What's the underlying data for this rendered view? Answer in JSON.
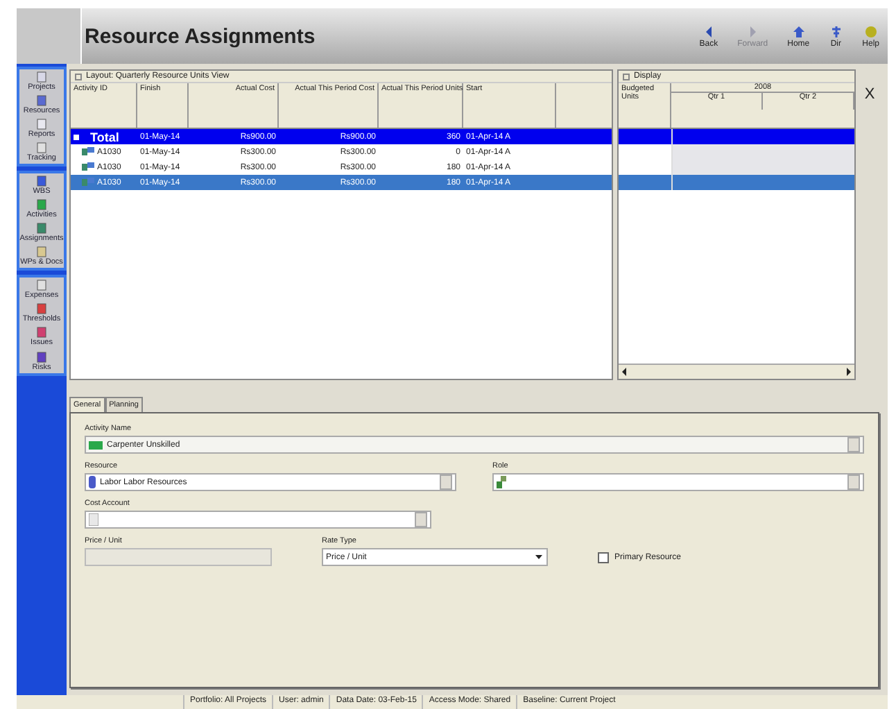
{
  "header": {
    "title": "Resource Assignments",
    "buttons": [
      {
        "label": "Back",
        "kind": "back",
        "disabled": false
      },
      {
        "label": "Forward",
        "kind": "forward",
        "disabled": true
      },
      {
        "label": "Home",
        "kind": "home",
        "disabled": false
      },
      {
        "label": "Dir",
        "kind": "dir",
        "disabled": false
      },
      {
        "label": "Help",
        "kind": "help",
        "disabled": false
      }
    ]
  },
  "sidebar": {
    "groups": [
      [
        {
          "label": "Projects",
          "kind": "projects"
        },
        {
          "label": "Resources",
          "kind": "resources"
        },
        {
          "label": "Reports",
          "kind": "reports"
        },
        {
          "label": "Tracking",
          "kind": "tracking"
        }
      ],
      [
        {
          "label": "WBS",
          "kind": "wbs"
        },
        {
          "label": "Activities",
          "kind": "activities"
        },
        {
          "label": "Assignments",
          "kind": "assignments"
        },
        {
          "label": "WPs & Docs",
          "kind": "docs"
        }
      ],
      [
        {
          "label": "Expenses",
          "kind": "expenses"
        },
        {
          "label": "Thresholds",
          "kind": "thresholds"
        },
        {
          "label": "Issues",
          "kind": "issues"
        },
        {
          "label": "Risks",
          "kind": "risks"
        }
      ]
    ]
  },
  "table": {
    "layout": "Layout: Quarterly Resource Units View",
    "columns": [
      "Activity ID",
      "Finish",
      "Actual Cost",
      "Actual This Period Cost",
      "Actual This Period Units",
      "Start"
    ],
    "rows": [
      {
        "kind": "total",
        "selected": false,
        "cells": [
          "Total",
          "01-May-14",
          "Rs900.00",
          "Rs900.00",
          "360",
          "01-Apr-14 A"
        ]
      },
      {
        "kind": "activity",
        "selected": false,
        "cells": [
          "A1030",
          "01-May-14",
          "Rs300.00",
          "Rs300.00",
          "0",
          "01-Apr-14 A"
        ]
      },
      {
        "kind": "activity",
        "selected": false,
        "cells": [
          "A1030",
          "01-May-14",
          "Rs300.00",
          "Rs300.00",
          "180",
          "01-Apr-14 A"
        ]
      },
      {
        "kind": "activity",
        "selected": true,
        "cells": [
          "A1030",
          "01-May-14",
          "Rs300.00",
          "Rs300.00",
          "180",
          "01-Apr-14 A"
        ]
      }
    ]
  },
  "gantt": {
    "display": "Display",
    "budgeted_units": "Budgeted Units",
    "year": "2008",
    "quarters": [
      "Qtr 1",
      "Qtr 2"
    ]
  },
  "close_label": "X",
  "details": {
    "tabs": [
      {
        "label": "General",
        "selected": true
      },
      {
        "label": "Planning",
        "selected": false
      }
    ],
    "activity_name": {
      "label": "Activity Name",
      "value": "Carpenter Unskilled"
    },
    "resource": {
      "label": "Resource",
      "value": "Labor  Labor Resources"
    },
    "role": {
      "label": "Role"
    },
    "cost_account": {
      "label": "Cost Account"
    },
    "price_unit": {
      "label": "Price / Unit"
    },
    "rate_type": {
      "label": "Rate Type",
      "value": "Price / Unit"
    },
    "primary_resource": {
      "label": "Primary Resource",
      "checked": false
    }
  },
  "status_bar": [
    "Portfolio: All Projects",
    "User: admin",
    "Data Date: 03-Feb-15",
    "Access Mode: Shared",
    "Baseline: Current Project"
  ]
}
